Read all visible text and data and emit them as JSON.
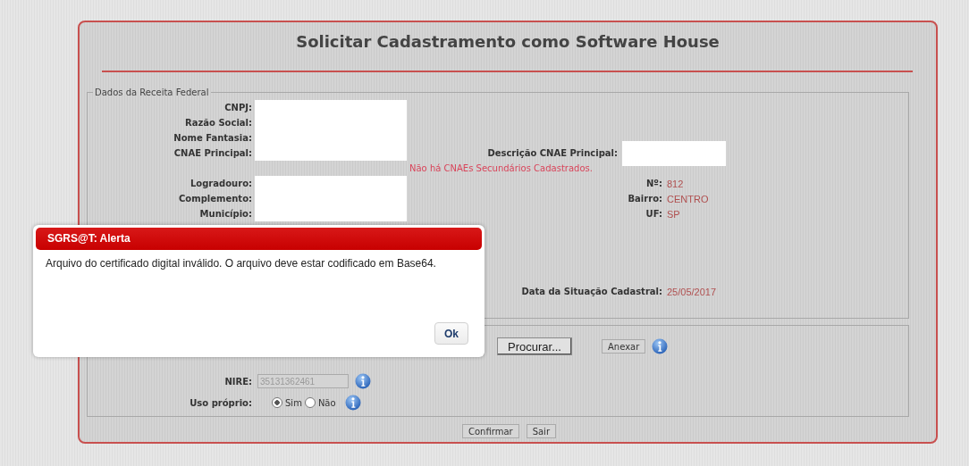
{
  "title": "Solicitar Cadastramento como Software House",
  "receita": {
    "legend": "Dados da Receita Federal",
    "rows": [
      {
        "kind": "pair",
        "left": {
          "label": "CNPJ:",
          "redacted": true
        }
      },
      {
        "kind": "pair",
        "left": {
          "label": "Razão Social:",
          "redacted": true
        }
      },
      {
        "kind": "pair",
        "left": {
          "label": "Nome Fantasia:",
          "redacted": true
        }
      },
      {
        "kind": "pair",
        "left": {
          "label": "CNAE Principal:",
          "redacted": true
        },
        "right": {
          "label": "Descrição CNAE Principal:",
          "redacted": true
        }
      },
      {
        "kind": "message",
        "text": "Não há CNAEs Secundários Cadastrados."
      },
      {
        "kind": "pair",
        "left": {
          "label": "Logradouro:",
          "redacted": true
        },
        "right": {
          "label": "Nº:",
          "value": "812"
        }
      },
      {
        "kind": "pair",
        "left": {
          "label": "Complemento:",
          "redacted": true
        },
        "right": {
          "label": "Bairro:",
          "value": "CENTRO"
        }
      },
      {
        "kind": "pair",
        "left": {
          "label": "Município:",
          "redacted": true
        },
        "right": {
          "label": "UF:",
          "value": "SP"
        }
      },
      {
        "kind": "pair",
        "right": {
          "label": "Data da Situação Cadastral:",
          "value": "25/05/2017"
        }
      }
    ]
  },
  "attachment": {
    "browse_button": "Procurar...",
    "attach_button": "Anexar"
  },
  "nire": {
    "label": "NIRE:",
    "value": "35131362461",
    "disabled": true
  },
  "uso_proprio": {
    "label": "Uso próprio:",
    "options": [
      {
        "label": "Sim",
        "selected": true
      },
      {
        "label": "Não",
        "selected": false
      }
    ]
  },
  "buttons": [
    "Confirmar",
    "Sair"
  ],
  "dialog": {
    "title": "SGRS@T: Alerta",
    "message": "Arquivo do certificado digital inválido. O arquivo deve estar codificado em Base64.",
    "button": "Ok"
  }
}
